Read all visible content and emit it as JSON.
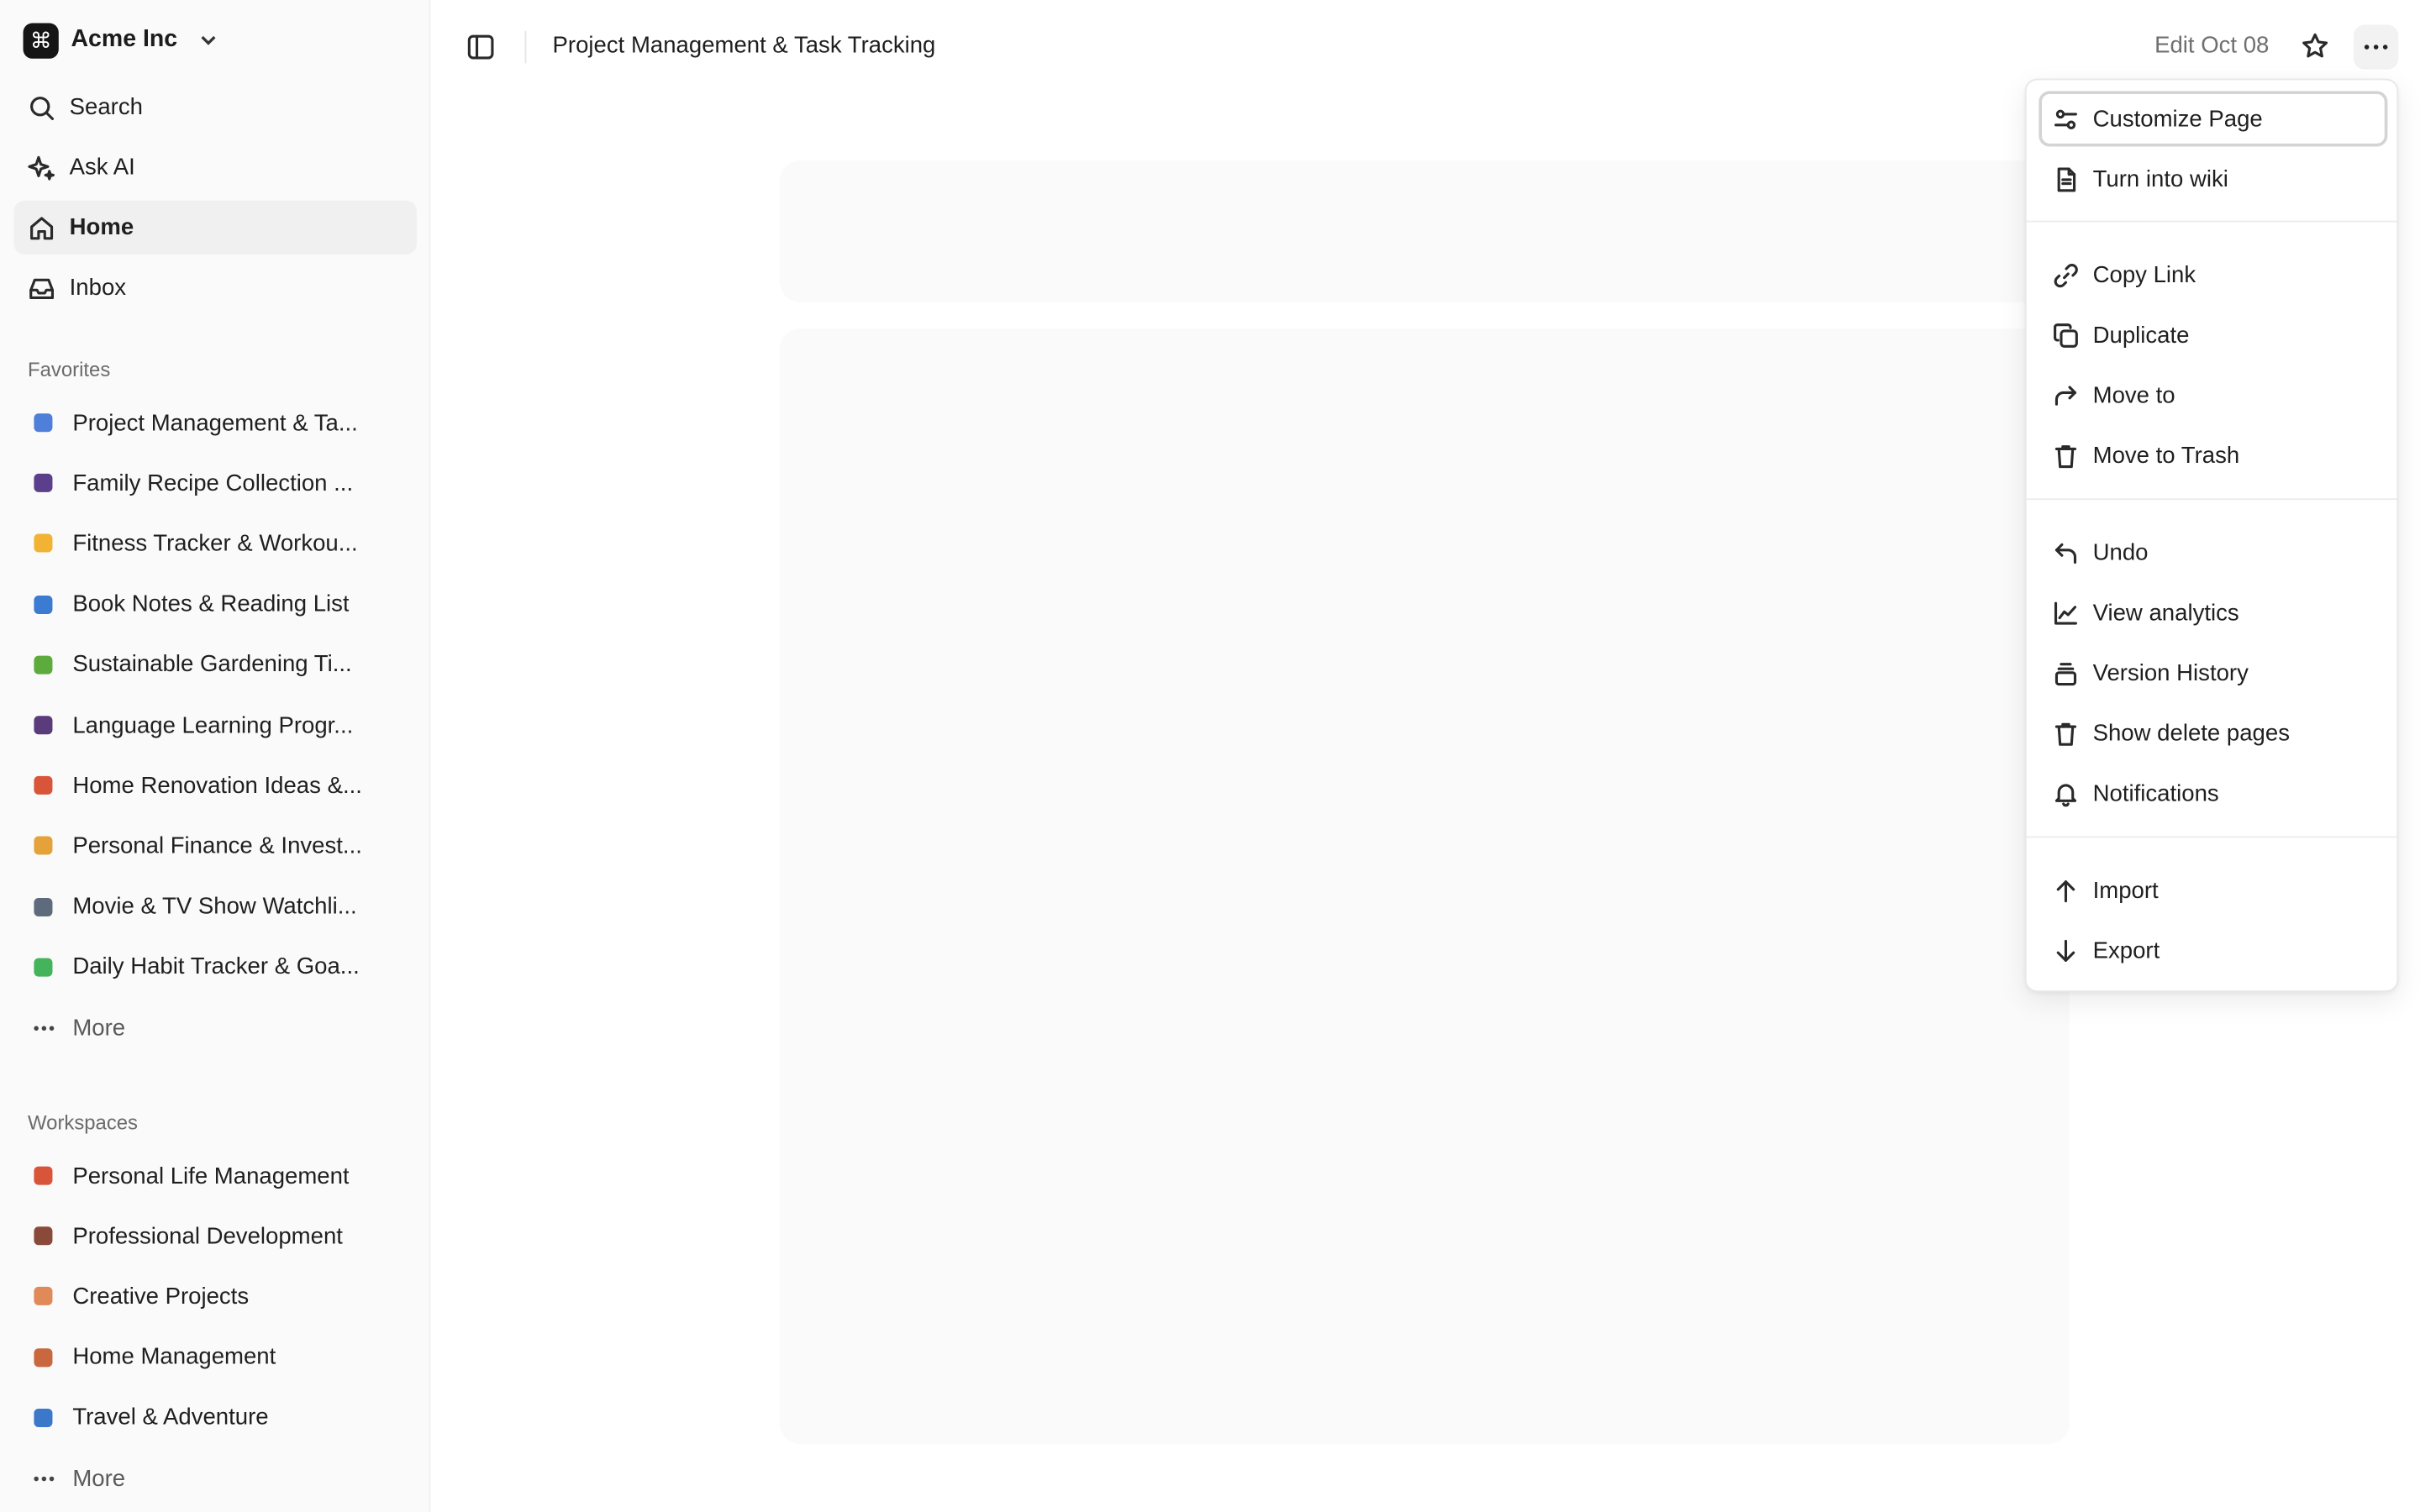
{
  "workspace": {
    "name": "Acme Inc",
    "logo_glyph": "⌘"
  },
  "nav": {
    "search": "Search",
    "ask_ai": "Ask AI",
    "home": "Home",
    "inbox": "Inbox"
  },
  "favorites": {
    "label": "Favorites",
    "items": [
      {
        "label": "Project Management & Ta...",
        "icon": "bar-chart-emoji",
        "color": "#4f7fd8"
      },
      {
        "label": "Family Recipe Collection ...",
        "icon": "magnifier-emoji",
        "color": "#5b3f8a"
      },
      {
        "label": "Fitness Tracker & Workou...",
        "icon": "flexed-biceps-emoji",
        "color": "#f2b233"
      },
      {
        "label": "Book Notes & Reading List",
        "icon": "books-emoji",
        "color": "#3b7bd1"
      },
      {
        "label": "Sustainable Gardening Ti...",
        "icon": "seedling-emoji",
        "color": "#5cab3c"
      },
      {
        "label": "Language Learning Progr...",
        "icon": "speaking-head-emoji",
        "color": "#5a3b7c"
      },
      {
        "label": "Home Renovation Ideas &...",
        "icon": "house-emoji",
        "color": "#d9553a"
      },
      {
        "label": "Personal Finance & Invest...",
        "icon": "money-bag-emoji",
        "color": "#e6a23a"
      },
      {
        "label": "Movie & TV Show Watchli...",
        "icon": "clapper-board-emoji",
        "color": "#5e6b7d"
      },
      {
        "label": "Daily Habit Tracker & Goa...",
        "icon": "check-mark-emoji",
        "color": "#44b35b"
      }
    ],
    "more": "More"
  },
  "workspaces": {
    "label": "Workspaces",
    "items": [
      {
        "label": "Personal Life Management",
        "icon": "house-emoji",
        "color": "#d9553a"
      },
      {
        "label": "Professional Development",
        "icon": "briefcase-emoji",
        "color": "#8a4a3a"
      },
      {
        "label": "Creative Projects",
        "icon": "palette-emoji",
        "color": "#e08a5a"
      },
      {
        "label": "Home Management",
        "icon": "house-garden-emoji",
        "color": "#c9683f"
      },
      {
        "label": "Travel & Adventure",
        "icon": "luggage-emoji",
        "color": "#3b78c9"
      }
    ],
    "more": "More"
  },
  "header": {
    "breadcrumb": "Project Management & Task Tracking",
    "edit_date": "Edit Oct 08"
  },
  "menu": {
    "groups": [
      [
        {
          "label": "Customize Page",
          "icon": "sliders-icon"
        },
        {
          "label": "Turn into wiki",
          "icon": "file-text-icon"
        }
      ],
      [
        {
          "label": "Copy Link",
          "icon": "link-icon"
        },
        {
          "label": "Duplicate",
          "icon": "copy-icon"
        },
        {
          "label": "Move to",
          "icon": "forward-arrow-icon"
        },
        {
          "label": "Move to Trash",
          "icon": "trash-icon"
        }
      ],
      [
        {
          "label": "Undo",
          "icon": "undo-icon"
        },
        {
          "label": "View analytics",
          "icon": "line-chart-icon"
        },
        {
          "label": "Version History",
          "icon": "layers-icon"
        },
        {
          "label": "Show delete pages",
          "icon": "trash-icon"
        },
        {
          "label": "Notifications",
          "icon": "bell-icon"
        }
      ],
      [
        {
          "label": "Import",
          "icon": "arrow-up-icon"
        },
        {
          "label": "Export",
          "icon": "arrow-down-icon"
        }
      ]
    ]
  }
}
